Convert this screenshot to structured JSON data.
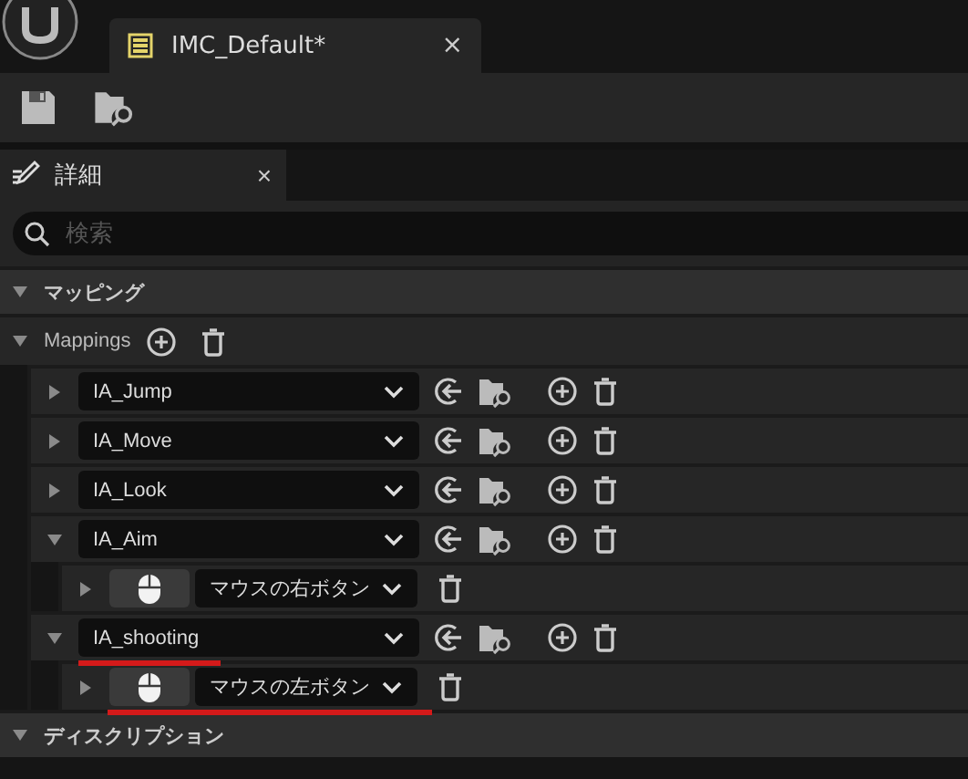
{
  "asset_tab": {
    "title": "IMC_Default*",
    "close": "×"
  },
  "details_tab": {
    "title": "詳細",
    "close": "×"
  },
  "search": {
    "placeholder": "検索"
  },
  "sections": [
    {
      "title": "マッピング",
      "expanded": true,
      "kind": "mappings"
    },
    {
      "title": "ディスクリプション",
      "expanded": true,
      "kind": "plain"
    }
  ],
  "mappings": {
    "label": "Mappings",
    "expanded": true,
    "items": [
      {
        "action": "IA_Jump",
        "expanded": false,
        "underlined": false
      },
      {
        "action": "IA_Move",
        "expanded": false,
        "underlined": false
      },
      {
        "action": "IA_Look",
        "expanded": false,
        "underlined": false
      },
      {
        "action": "IA_Aim",
        "expanded": true,
        "underlined": false,
        "bindings": [
          {
            "key": "マウスの右ボタン",
            "expanded": false,
            "underlined": false
          }
        ]
      },
      {
        "action": "IA_shooting",
        "expanded": true,
        "underlined": true,
        "bindings": [
          {
            "key": "マウスの左ボタン",
            "expanded": false,
            "underlined": true
          }
        ]
      }
    ]
  }
}
